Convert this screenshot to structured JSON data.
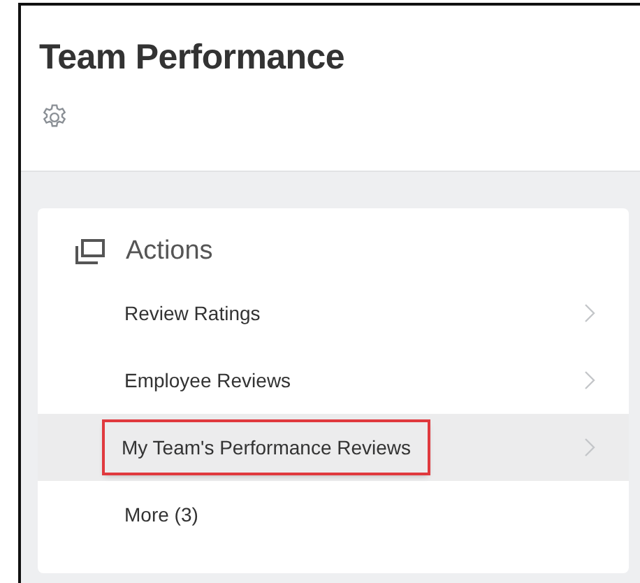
{
  "page": {
    "title": "Team Performance"
  },
  "actions": {
    "heading": "Actions",
    "items": [
      {
        "label": "Review Ratings",
        "selected": false,
        "chevron": true,
        "annotated": false
      },
      {
        "label": "Employee Reviews",
        "selected": false,
        "chevron": true,
        "annotated": false
      },
      {
        "label": "My Team's Performance Reviews",
        "selected": true,
        "chevron": true,
        "annotated": true
      },
      {
        "label": "More (3)",
        "selected": false,
        "chevron": false,
        "annotated": false
      }
    ]
  }
}
